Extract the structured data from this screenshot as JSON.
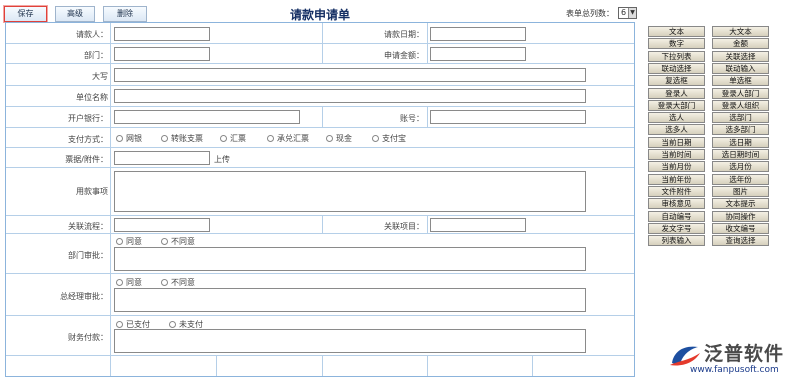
{
  "toolbar": {
    "save": "保存",
    "advanced": "高级",
    "delete": "删除"
  },
  "form_title": "请款申请单",
  "column_count": {
    "label": "表单总列数：",
    "value": "6"
  },
  "fields": {
    "requester": "请款人：",
    "request_date": "请款日期：",
    "department": "部门：",
    "amount": "申请金额：",
    "amount_upper": "大写",
    "company_name": "单位名称",
    "bank": "开户银行：",
    "account": "账号：",
    "payment_method": "支付方式：",
    "attachment": "票据/附件：",
    "upload": "上传",
    "purpose": "用款事项",
    "related_flow": "关联流程：",
    "related_project": "关联项目：",
    "dept_approval": "部门审批：",
    "gm_approval": "总经理审批：",
    "finance_payment": "财务付款："
  },
  "payment_options": [
    "网银",
    "转账支票",
    "汇票",
    "承兑汇票",
    "现金",
    "支付宝"
  ],
  "approval_options": {
    "agree": "同意",
    "disagree": "不同意"
  },
  "payment_status_options": {
    "paid": "已支付",
    "unpaid": "未支付"
  },
  "palette": [
    [
      "文本",
      "大文本"
    ],
    [
      "数字",
      "金额"
    ],
    [
      "下拉列表",
      "关联选择"
    ],
    [
      "联动选择",
      "联动输入"
    ],
    [
      "复选框",
      "单选框"
    ],
    [
      "登录人",
      "登录人部门"
    ],
    [
      "登录大部门",
      "登录人组织"
    ],
    [
      "选人",
      "选部门"
    ],
    [
      "选多人",
      "选多部门"
    ],
    [
      "当前日期",
      "选日期"
    ],
    [
      "当前时间",
      "选日期时间"
    ],
    [
      "当前月份",
      "选月份"
    ],
    [
      "当前年份",
      "选年份"
    ],
    [
      "文件附件",
      "图片"
    ],
    [
      "审核意见",
      "文本提示"
    ],
    [
      "自动编号",
      "协同操作"
    ],
    [
      "发文字号",
      "收文编号"
    ],
    [
      "列表输入",
      "查询选择"
    ]
  ],
  "logo": {
    "name": "泛普软件",
    "url": "www.fanpusoft.com"
  }
}
